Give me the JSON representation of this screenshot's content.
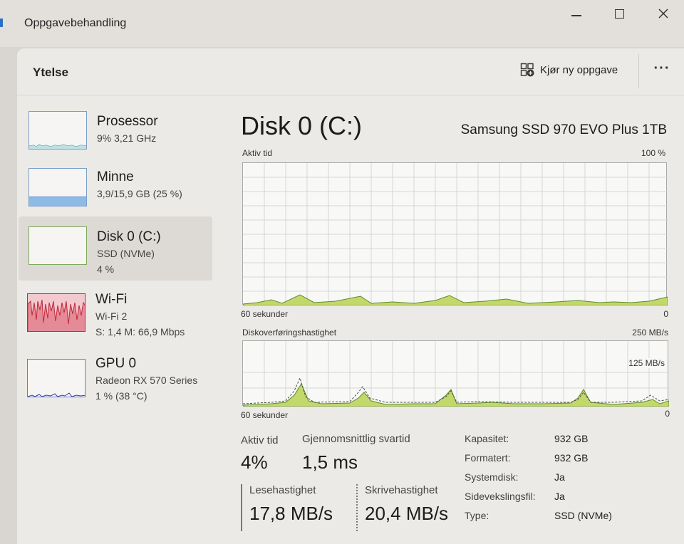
{
  "window": {
    "title": "Oppgavebehandling"
  },
  "header": {
    "title": "Ytelse",
    "run_task_label": "Kjør ny oppgave",
    "more_label": "···"
  },
  "sidebar": {
    "items": [
      {
        "name": "Prosessor",
        "sub1": "9%  3,21 GHz",
        "sub2": "",
        "color": "#3a9aa6"
      },
      {
        "name": "Minne",
        "sub1": "3,9/15,9 GB (25 %)",
        "sub2": "",
        "color": "#5b95d4"
      },
      {
        "name": "Disk 0 (C:)",
        "sub1": "SSD (NVMe)",
        "sub2": "4 %",
        "color": "#5e8a2a"
      },
      {
        "name": "Wi-Fi",
        "sub1": "Wi-Fi 2",
        "sub2": "S: 1,4  M: 66,9 Mbps",
        "color": "#c0283a"
      },
      {
        "name": "GPU 0",
        "sub1": "Radeon RX 570 Series",
        "sub2": "1 % (38 °C)",
        "color": "#2f3fa8"
      }
    ]
  },
  "main": {
    "title": "Disk 0 (C:)",
    "model": "Samsung SSD 970 EVO Plus 1TB",
    "chart1": {
      "label": "Aktiv tid",
      "max_label": "100 %",
      "time_label": "60 sekunder",
      "zero_label": "0"
    },
    "chart2": {
      "label": "Diskoverføringshastighet",
      "max_label": "250 MB/s",
      "mid_label": "125 MB/s",
      "time_label": "60 sekunder",
      "zero_label": "0"
    },
    "stats": {
      "active_label": "Aktiv tid",
      "active_value": "4%",
      "response_label": "Gjennomsnittlig svartid",
      "response_value": "1,5 ms",
      "read_label": "Lesehastighet",
      "read_value": "17,8 MB/s",
      "write_label": "Skrivehastighet",
      "write_value": "20,4 MB/s"
    },
    "properties": [
      {
        "key": "Kapasitet:",
        "value": "932 GB"
      },
      {
        "key": "Formatert:",
        "value": "932 GB"
      },
      {
        "key": "Systemdisk:",
        "value": "Ja"
      },
      {
        "key": "Sidevekslingsfil:",
        "value": "Ja"
      },
      {
        "key": "Type:",
        "value": "SSD (NVMe)"
      }
    ]
  },
  "colors": {
    "disk_fill": "#c3d86a",
    "disk_line": "#5e8a2a",
    "grid": "#d6d6d6"
  }
}
